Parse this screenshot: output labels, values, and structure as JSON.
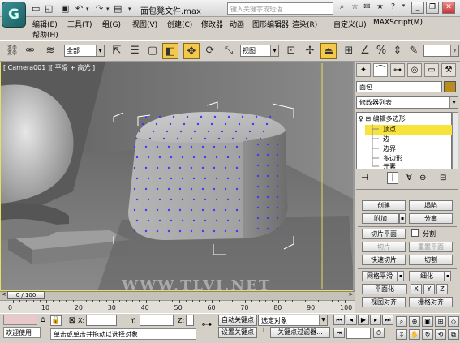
{
  "title_bar": {
    "title": "面包凳文件.max",
    "search_placeholder": "键入关键字或短语"
  },
  "menu": [
    "编辑(E)",
    "工具(T)",
    "组(G)",
    "视图(V)",
    "创建(C)",
    "修改器",
    "动画",
    "图形编辑器",
    "渲染(R)",
    "自定义(U)",
    "MAXScript(M)",
    "帮助(H)"
  ],
  "toolbar": {
    "selection_filter": "全部",
    "reference_coord": "视图"
  },
  "viewport": {
    "label": "[ Camera001 ][ 平滑 + 高光 ]",
    "watermark": "WWW.TLVI.NET"
  },
  "command_panel": {
    "object_name": "面包",
    "object_color": "#b88c1e",
    "modifier_list": "修改器列表",
    "stack": {
      "modifier": "编辑多边形",
      "sub_objects": [
        "顶点",
        "边",
        "边界",
        "多边形",
        "元素"
      ],
      "selected": "顶点"
    },
    "buttons": {
      "create": "创建",
      "collapse": "塌陷",
      "attach": "附加",
      "detach": "分离",
      "slice_plane": "切片平面",
      "split": "分割",
      "slice": "切片",
      "reset_plane": "重置平面",
      "quickslice": "快速切片",
      "cut": "切割",
      "msmooth": "网格平滑",
      "tessellate": "细化",
      "make_planar": "平面化",
      "x": "X",
      "y": "Y",
      "z": "Z",
      "view_align": "视图对齐",
      "grid_align": "栅格对齐"
    }
  },
  "timeline": {
    "frame_display": "0 / 100",
    "ticks": [
      "0",
      "10",
      "20",
      "30",
      "40",
      "50",
      "60",
      "70",
      "80",
      "90",
      "100"
    ]
  },
  "status_bar": {
    "welcome": "欢迎使用",
    "prompt": "单击或单击并拖动以选择对象",
    "x_label": "X:",
    "y_label": "Y:",
    "z_label": "Z:",
    "auto_key": "自动关键点",
    "set_key": "设置关键点",
    "key_mode": "选定对象",
    "key_filters": "关键点过滤器..."
  }
}
